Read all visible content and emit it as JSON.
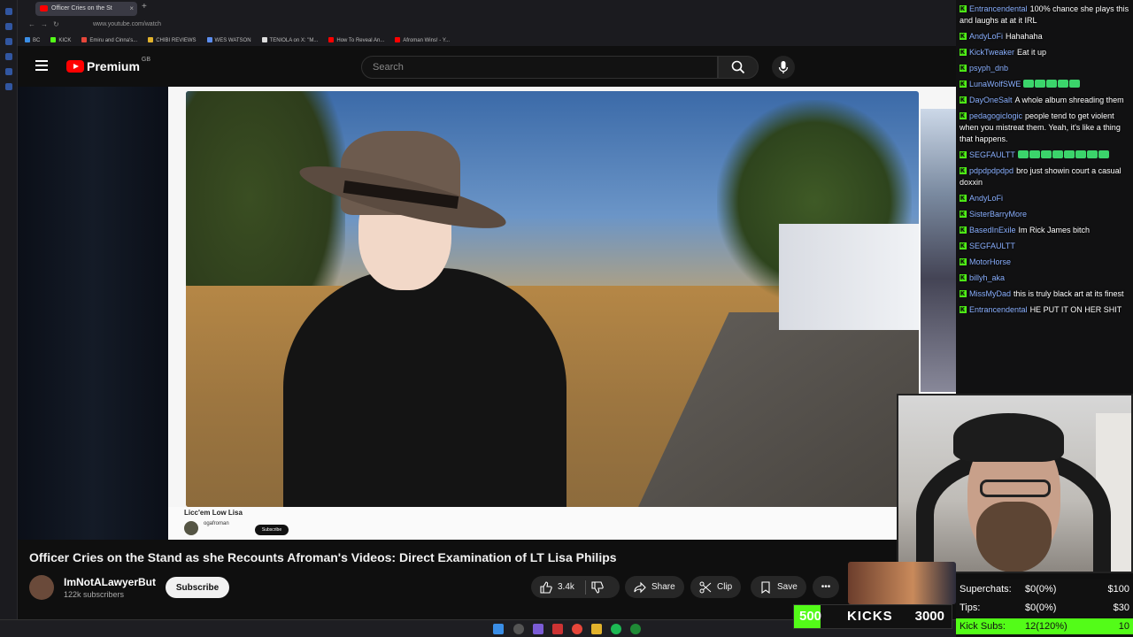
{
  "browser": {
    "tab_title": "Officer Cries on the St",
    "url": "www.youtube.com/watch",
    "bookmarks": [
      "BC",
      "KICK",
      "Emiru and Cinna's...",
      "CHIBI REVIEWS",
      "WES WATSON",
      "TENIOLA on X: \"M...",
      "How To Reveal An...",
      "Afroman Wins! - Y..."
    ]
  },
  "youtube": {
    "logo": "Premium",
    "region": "GB",
    "search_placeholder": "Search"
  },
  "video": {
    "inner_title": "Licc'em Low Lisa",
    "inner_channel": "ogafroman",
    "inner_subscribe": "Subscribe",
    "title": "Officer Cries on the Stand as she Recounts Afroman's Videos: Direct Examination of LT Lisa Philips",
    "channel": "ImNotALawyerBut",
    "subscribers": "122k subscribers",
    "subscribe_label": "Subscribe",
    "likes": "3.4k",
    "share_label": "Share",
    "clip_label": "Clip",
    "save_label": "Save"
  },
  "chat": [
    {
      "user": "Entrancendental",
      "text": "100% chance she plays this and laughs at at it IRL"
    },
    {
      "user": "AndyLoFi",
      "text": "Hahahaha"
    },
    {
      "user": "KickTweaker",
      "text": "Eat it up"
    },
    {
      "user": "psyph_dnb",
      "text": ""
    },
    {
      "user": "LunaWolfSWE",
      "text": "",
      "emotes": 5
    },
    {
      "user": "DayOneSalt",
      "text": "A whole album shreading them"
    },
    {
      "user": "pedagogiclogic",
      "text": "people tend to get violent when you mistreat them. Yeah, it's like a thing that happens."
    },
    {
      "user": "SEGFAULTT",
      "text": "",
      "emotes": 8
    },
    {
      "user": "pdpdpdpdpd",
      "text": "bro just showin court a casual doxxin"
    },
    {
      "user": "AndyLoFi",
      "text": ""
    },
    {
      "user": "SisterBarryMore",
      "text": ""
    },
    {
      "user": "BasedInExile",
      "text": "Im Rick James bitch"
    },
    {
      "user": "SEGFAULTT",
      "text": ""
    },
    {
      "user": "MotorHorse",
      "text": ""
    },
    {
      "user": "billyh_aka",
      "text": ""
    },
    {
      "user": "MissMyDad",
      "text": "this is truly black art at its finest"
    },
    {
      "user": "Entrancendental",
      "text": "HE PUT IT ON HER SHIT"
    }
  ],
  "stats": {
    "superchats_label": "Superchats:",
    "superchats_value": "$0(0%)",
    "superchats_goal": "$100",
    "tips_label": "Tips:",
    "tips_value": "$0(0%)",
    "tips_goal": "$30",
    "subs_label": "Kick Subs:",
    "subs_value": "12(120%)",
    "subs_goal": "10"
  },
  "kicks": {
    "current": "500",
    "label": "KICKS",
    "goal": "3000",
    "progress": 0.167
  }
}
